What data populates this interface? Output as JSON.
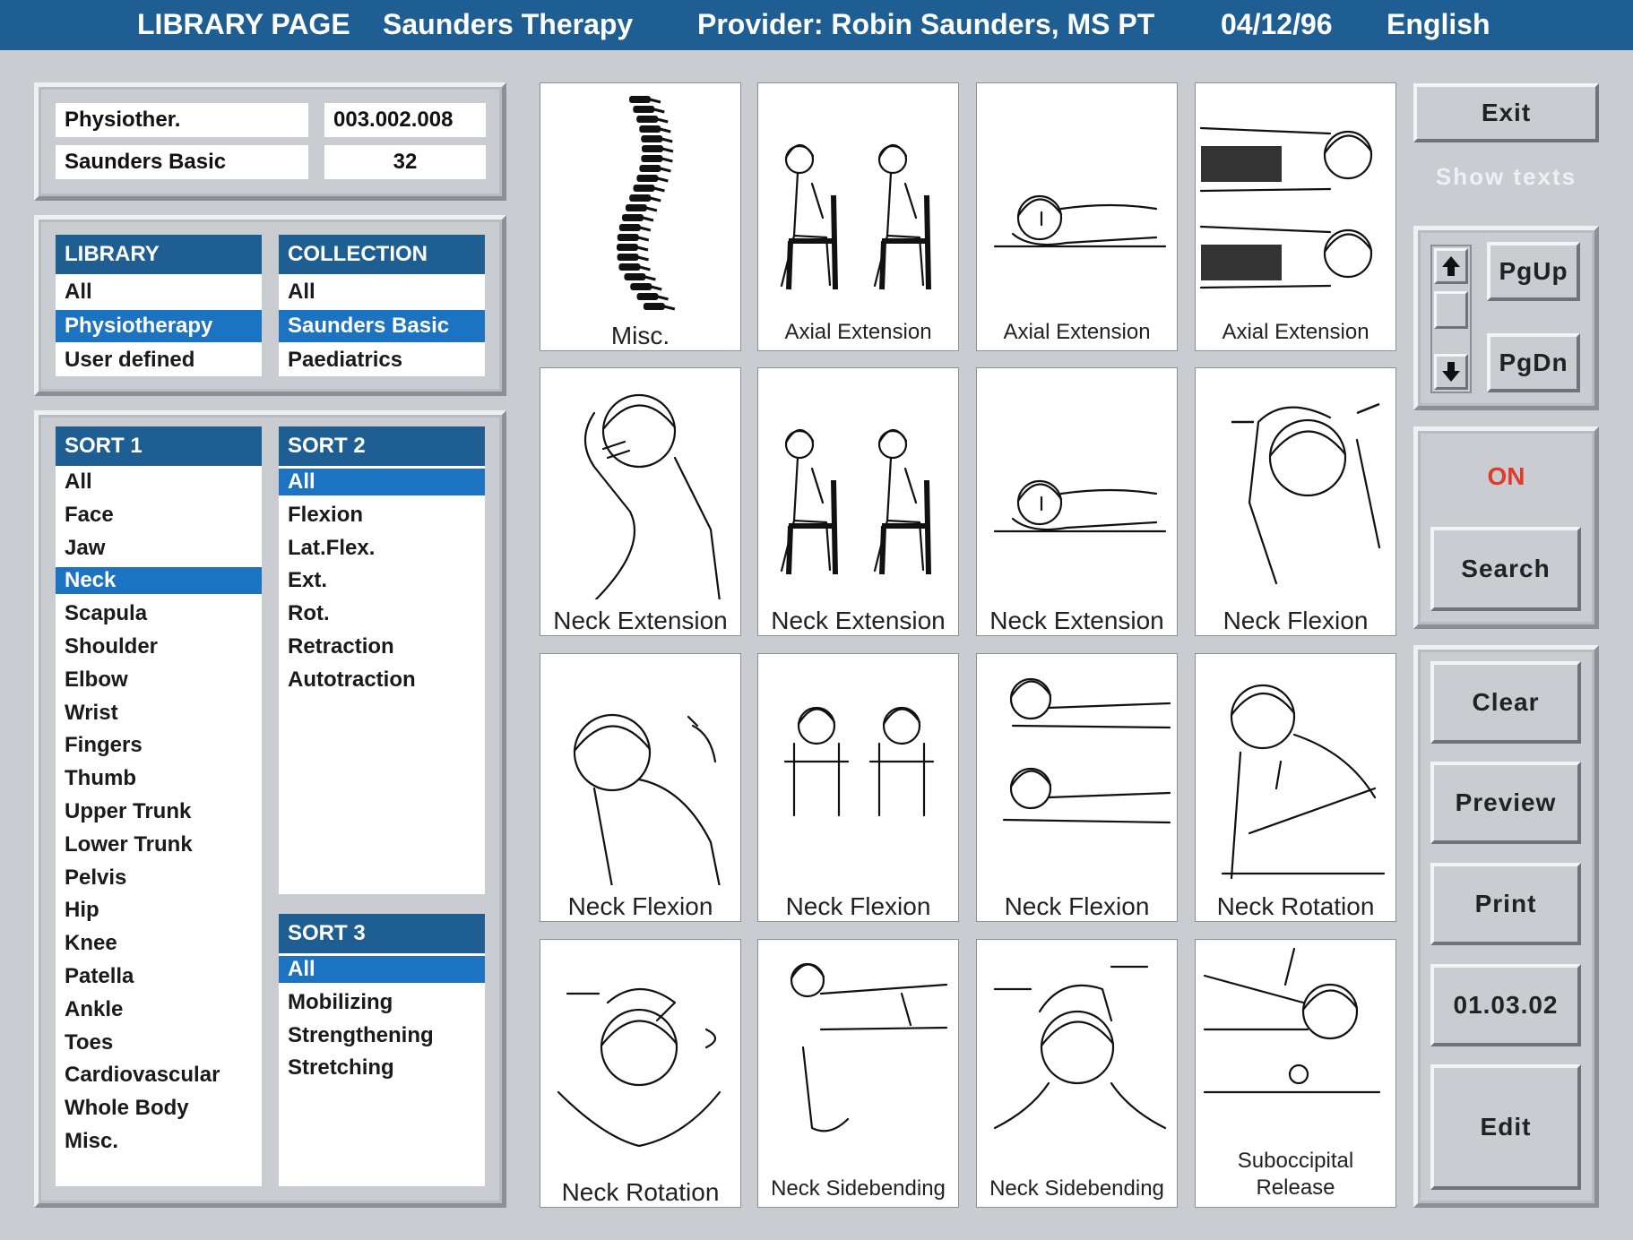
{
  "header": {
    "page": "LIBRARY PAGE",
    "practice": "Saunders Therapy",
    "provider": "Provider: Robin Saunders, MS PT",
    "date": "04/12/96",
    "language": "English"
  },
  "info": {
    "row1_label": "Physiother.",
    "row1_value": "003.002.008",
    "row2_label": "Saunders Basic",
    "row2_value": "32"
  },
  "library": {
    "header": "LIBRARY",
    "items": [
      "All",
      "Physiotherapy",
      "User defined"
    ],
    "selected": "Physiotherapy"
  },
  "collection": {
    "header": "COLLECTION",
    "items": [
      "All",
      "Saunders Basic",
      "Paediatrics"
    ],
    "selected": "Saunders Basic"
  },
  "sort1": {
    "header": "SORT 1",
    "items": [
      "All",
      "Face",
      "Jaw",
      "Neck",
      "Scapula",
      "Shoulder",
      "Elbow",
      "Wrist",
      "Fingers",
      "Thumb",
      "Upper Trunk",
      "Lower Trunk",
      "Pelvis",
      "Hip",
      "Knee",
      "Patella",
      "Ankle",
      "Toes",
      "Cardiovascular",
      "Whole Body",
      "Misc."
    ],
    "selected": "Neck"
  },
  "sort2": {
    "header": "SORT 2",
    "items": [
      "All",
      "Flexion",
      "Lat.Flex.",
      "Ext.",
      "Rot.",
      "Retraction",
      "Autotraction"
    ],
    "selected": "All"
  },
  "sort3": {
    "header": "SORT 3",
    "items": [
      "All",
      "Mobilizing",
      "Strengthening",
      "Stretching"
    ],
    "selected": "All"
  },
  "thumbnails": [
    {
      "label": "Misc.",
      "art": "spine"
    },
    {
      "label": "Axial Extension",
      "art": "seated-pair"
    },
    {
      "label": "Axial Extension",
      "art": "prone-head"
    },
    {
      "label": "Axial Extension",
      "art": "supine-towel"
    },
    {
      "label": "Neck Extension",
      "art": "hands-behind-head"
    },
    {
      "label": "Neck Extension",
      "art": "seated-pair"
    },
    {
      "label": "Neck Extension",
      "art": "prone-head"
    },
    {
      "label": "Neck Flexion",
      "art": "hands-on-head"
    },
    {
      "label": "Neck Flexion",
      "art": "head-bowed"
    },
    {
      "label": "Neck Flexion",
      "art": "arms-crossed-pair"
    },
    {
      "label": "Neck Flexion",
      "art": "supine-pair"
    },
    {
      "label": "Neck Rotation",
      "art": "side-lying"
    },
    {
      "label": "Neck Rotation",
      "art": "hand-on-forehead"
    },
    {
      "label": "Neck Sidebending",
      "art": "side-lying-arm"
    },
    {
      "label": "Neck Sidebending",
      "art": "hand-on-head-tilt"
    },
    {
      "label": "Suboccipital\nRelease",
      "art": "supine-roll"
    }
  ],
  "buttons": {
    "exit": "Exit",
    "show_texts": "Show texts",
    "pgup": "PgUp",
    "pgdn": "PgDn",
    "on": "ON",
    "search": "Search",
    "clear": "Clear",
    "preview": "Preview",
    "print": "Print",
    "code": "01.03.02",
    "edit": "Edit"
  },
  "colors": {
    "header_bg": "#1f5e93",
    "selection": "#1c73c2",
    "on_indicator": "#e23a2a",
    "panel_bg": "#c9ccd1"
  }
}
